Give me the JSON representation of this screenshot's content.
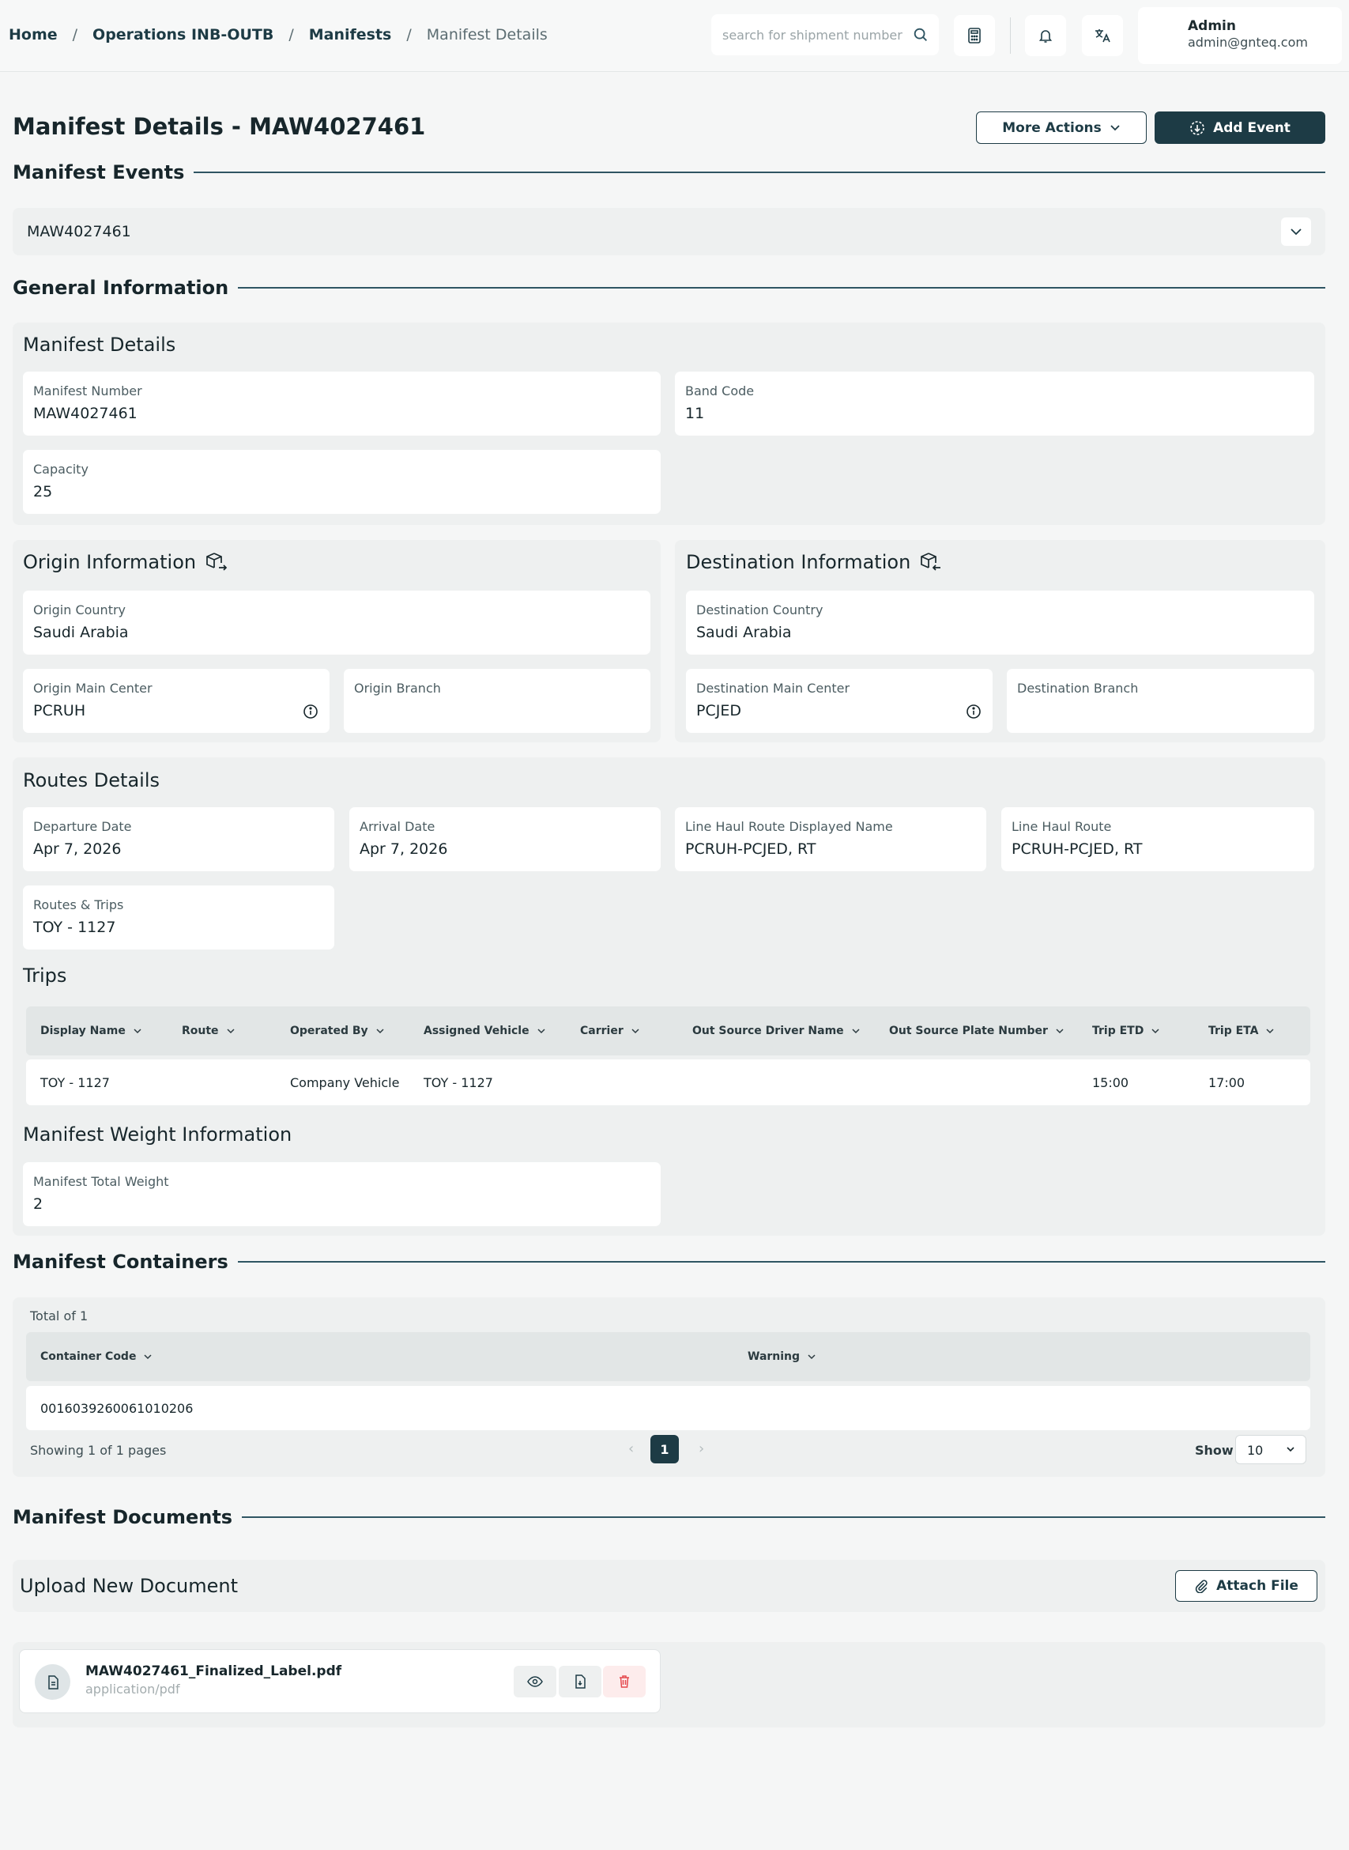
{
  "breadcrumb": [
    "Home",
    "Operations INB-OUTB",
    "Manifests",
    "Manifest Details"
  ],
  "search": {
    "placeholder": "search for shipment number"
  },
  "user": {
    "name": "Admin",
    "email": "admin@gnteq.com"
  },
  "page": {
    "title": "Manifest Details - MAW4027461",
    "more_actions": "More Actions",
    "add_event": "Add Event"
  },
  "sections": {
    "events": "Manifest Events",
    "general": "General Information",
    "containers": "Manifest Containers",
    "documents": "Manifest Documents"
  },
  "events": {
    "selected": "MAW4027461"
  },
  "manifest_details": {
    "heading": "Manifest Details",
    "fields": [
      {
        "label": "Manifest Number",
        "value": "MAW4027461"
      },
      {
        "label": "Band Code",
        "value": "11"
      },
      {
        "label": "Capacity",
        "value": "25"
      }
    ]
  },
  "origin": {
    "heading": "Origin Information",
    "country_label": "Origin Country",
    "country": "Saudi Arabia",
    "center_label": "Origin Main Center",
    "center": "PCRUH",
    "branch_label": "Origin Branch",
    "branch": ""
  },
  "destination": {
    "heading": "Destination Information",
    "country_label": "Destination Country",
    "country": "Saudi Arabia",
    "center_label": "Destination Main Center",
    "center": "PCJED",
    "branch_label": "Destination Branch",
    "branch": ""
  },
  "routes": {
    "heading": "Routes Details",
    "fields": [
      {
        "label": "Departure Date",
        "value": "Apr 7, 2026"
      },
      {
        "label": "Arrival Date",
        "value": "Apr 7, 2026"
      },
      {
        "label": "Line Haul Route Displayed Name",
        "value": "PCRUH-PCJED, RT"
      },
      {
        "label": "Line Haul Route",
        "value": "PCRUH-PCJED, RT"
      },
      {
        "label": "Routes & Trips",
        "value": "TOY - 1127"
      }
    ]
  },
  "trips": {
    "heading": "Trips",
    "columns": [
      "Display Name",
      "Route",
      "Operated By",
      "Assigned Vehicle",
      "Carrier",
      "Out Source Driver Name",
      "Out Source Plate Number",
      "Trip ETD",
      "Trip ETA"
    ],
    "rows": [
      [
        "TOY - 1127",
        "",
        "Company Vehicle",
        "TOY - 1127",
        "",
        "",
        "",
        "15:00",
        "17:00"
      ]
    ]
  },
  "weight": {
    "heading": "Manifest Weight Information",
    "label": "Manifest Total Weight",
    "value": "2"
  },
  "containers": {
    "total": "Total of 1",
    "columns": [
      "Container Code",
      "Warning"
    ],
    "rows": [
      [
        "0016039260061010206",
        ""
      ]
    ],
    "showing": "Showing 1 of 1 pages",
    "page": "1",
    "show_label": "Show",
    "page_size": "10"
  },
  "documents": {
    "upload_heading": "Upload New Document",
    "attach": "Attach File",
    "file_name": "MAW4027461_Finalized_Label.pdf",
    "file_type": "application/pdf"
  },
  "colors": {
    "primary": "#1d3b45",
    "panel": "#eef0f0",
    "danger": "#e5484d"
  }
}
